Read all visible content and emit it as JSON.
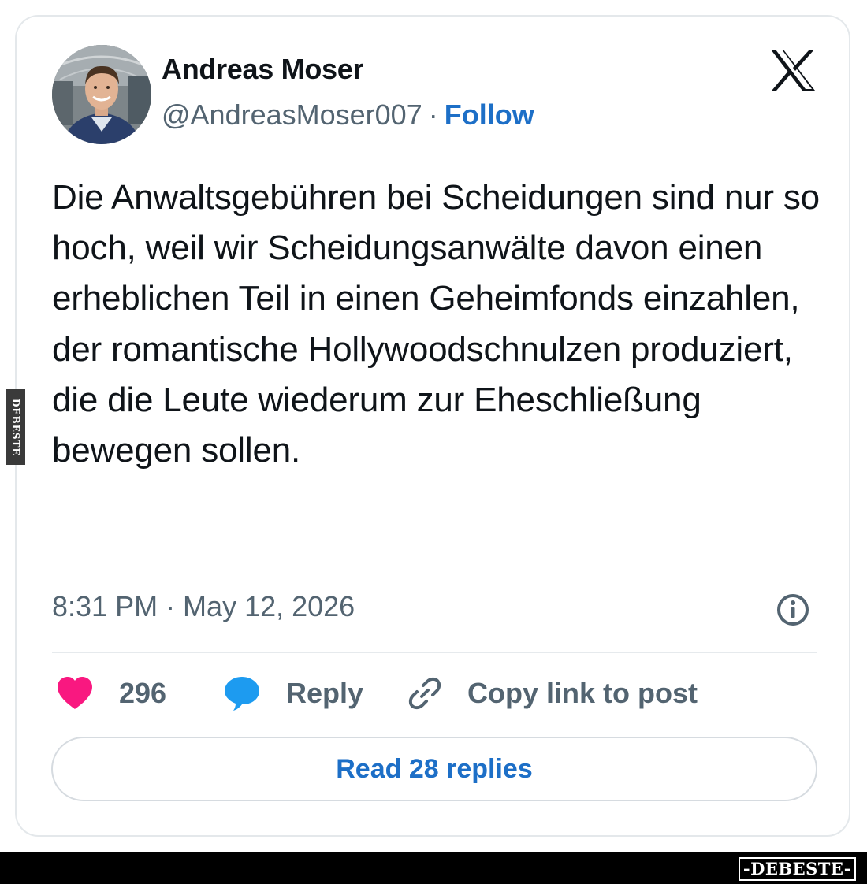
{
  "author": {
    "name": "Andreas Moser",
    "handle": "@AndreasMoser007",
    "separator": "·",
    "follow_label": "Follow"
  },
  "brand": {
    "logo_icon": "x-logo-icon"
  },
  "tweet": {
    "text": "Die Anwaltsgebühren bei Scheidungen sind nur so hoch, weil wir Scheidungsanwälte davon einen erheblichen Teil in einen Geheimfonds einzahlen, der romantische Hollywoodschnulzen produziert, die die Leute wiederum zur Eheschließung bewegen sollen.",
    "timestamp": "8:31 PM · May 12, 2026"
  },
  "actions": {
    "likes_count": "296",
    "reply_label": "Reply",
    "copy_link_label": "Copy link to post",
    "read_replies_label": "Read 28 replies"
  },
  "icons": {
    "like": "heart-icon",
    "reply": "speech-bubble-icon",
    "copy": "link-icon",
    "info": "info-icon"
  },
  "colors": {
    "heart": "#f91880",
    "reply_bubble": "#1d9bf0",
    "link_blue": "#1d6fc7",
    "muted_text": "#536471",
    "card_border": "#e4e8eb"
  },
  "watermark": {
    "side_text": "DEBESTE",
    "footer_text": "-DEBESTE-"
  }
}
